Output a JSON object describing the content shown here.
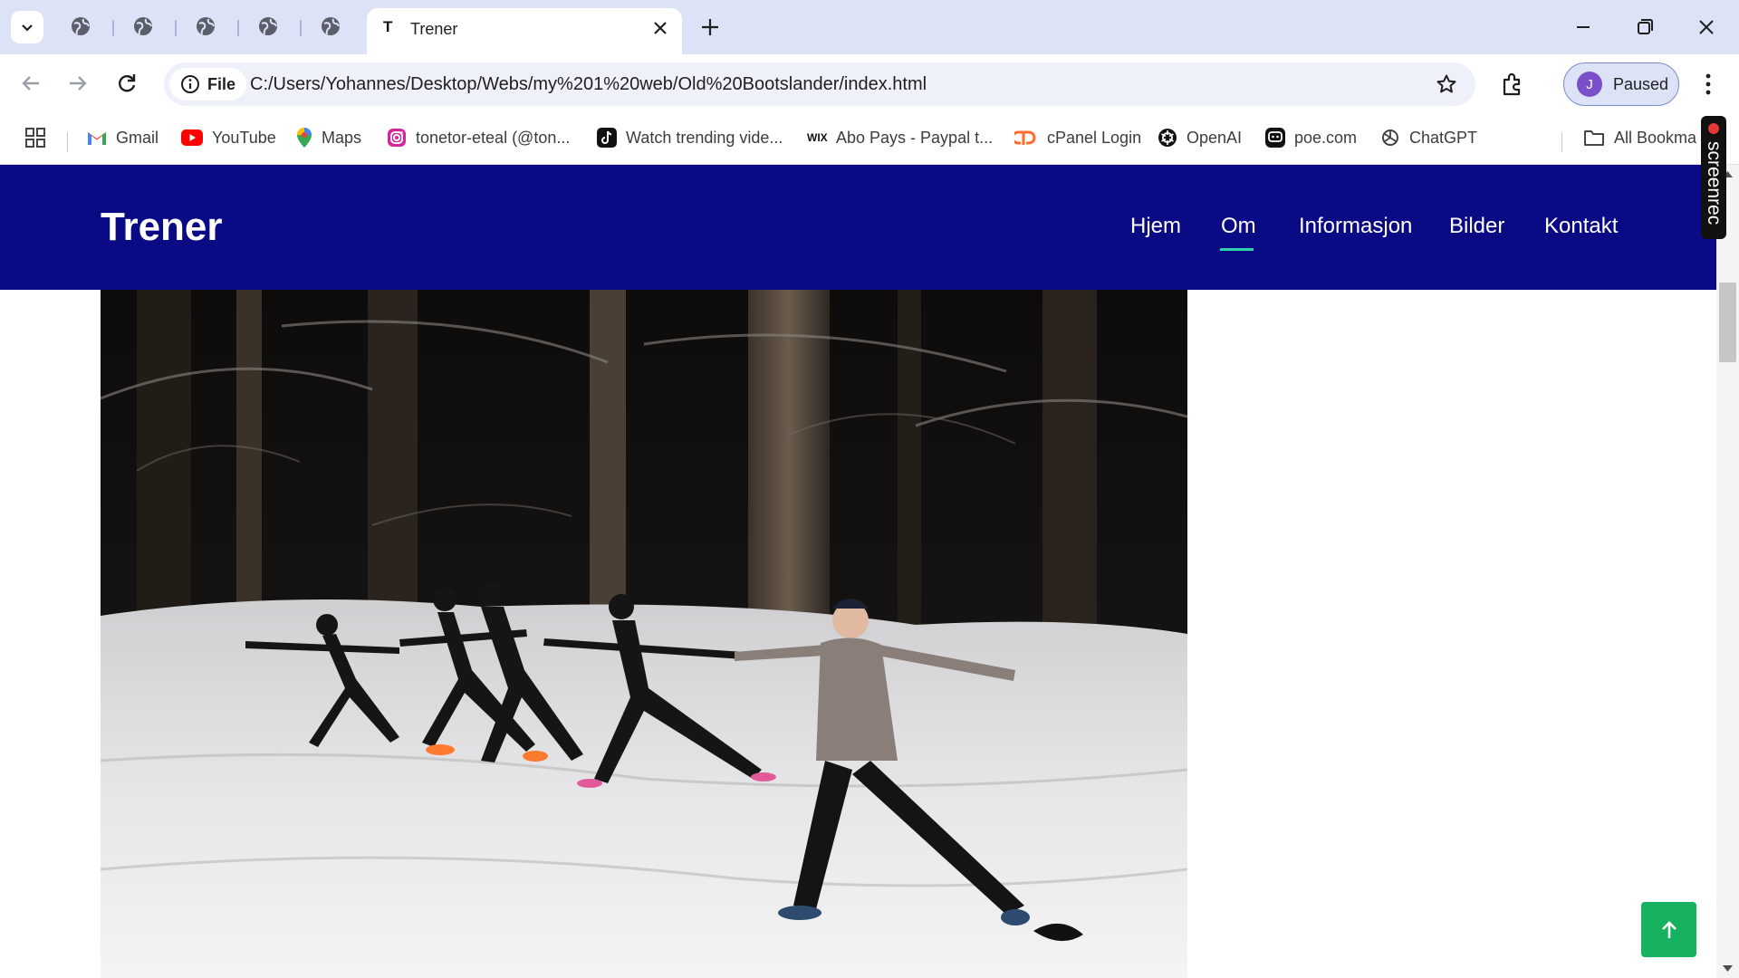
{
  "browser": {
    "active_tab": {
      "favicon_letter": "T",
      "title": "Trener"
    },
    "omnibox": {
      "chip_label": "File",
      "url": "C:/Users/Yohannes/Desktop/Webs/my%201%20web/Old%20Bootslander/index.html"
    },
    "profile": {
      "initial": "J",
      "status": "Paused"
    },
    "bookmarks": [
      {
        "label": "Gmail",
        "icon": "gmail-icon",
        "color": "#ea4335"
      },
      {
        "label": "YouTube",
        "icon": "youtube-icon",
        "color": "#ff0000"
      },
      {
        "label": "Maps",
        "icon": "maps-icon",
        "color": "#34a853"
      },
      {
        "label": "tonetor-eteal (@ton...",
        "icon": "instagram-icon",
        "color": "#d6249f"
      },
      {
        "label": "Watch trending vide...",
        "icon": "tiktok-icon",
        "color": "#111111"
      },
      {
        "label": "Abo Pays - Paypal t...",
        "icon": "wix-icon",
        "color": "#111111"
      },
      {
        "label": "cPanel Login",
        "icon": "cpanel-icon",
        "color": "#ff6c2c"
      },
      {
        "label": "OpenAI",
        "icon": "openai-icon",
        "color": "#111111"
      },
      {
        "label": "poe.com",
        "icon": "poe-icon",
        "color": "#111111"
      },
      {
        "label": "ChatGPT",
        "icon": "chatgpt-icon",
        "color": "#444444"
      }
    ],
    "all_bookmarks_label": "All Bookma",
    "screenrec_label": "screenrec"
  },
  "site": {
    "logo": "Trener",
    "nav": [
      "Hjem",
      "Om",
      "Informasjon",
      "Bilder",
      "Kontakt"
    ],
    "active_nav": "Om",
    "colors": {
      "header": "#0b0a85",
      "active_underline": "#2fd0a8",
      "to_top_button": "#16b25f"
    }
  }
}
